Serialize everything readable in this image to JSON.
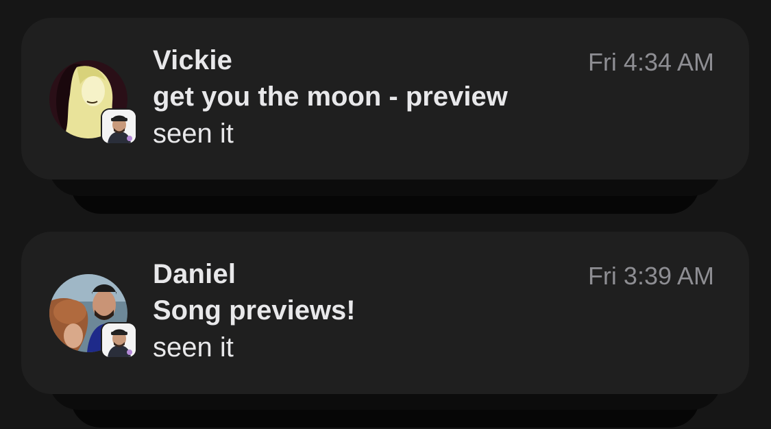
{
  "notifications": [
    {
      "sender": "Vickie",
      "time": "Fri 4:34 AM",
      "title": "get you the moon - preview",
      "body": "seen it",
      "avatar_icon": "user-avatar-vickie",
      "badge_icon": "app-badge-icon"
    },
    {
      "sender": "Daniel",
      "time": "Fri 3:39 AM",
      "title": "Song previews!",
      "body": "seen it",
      "avatar_icon": "user-avatar-daniel",
      "badge_icon": "app-badge-icon"
    }
  ],
  "colors": {
    "background": "#161616",
    "card": "#1f1f1f",
    "primary_text": "#e8e8ea",
    "secondary_text": "#8e8e93"
  }
}
